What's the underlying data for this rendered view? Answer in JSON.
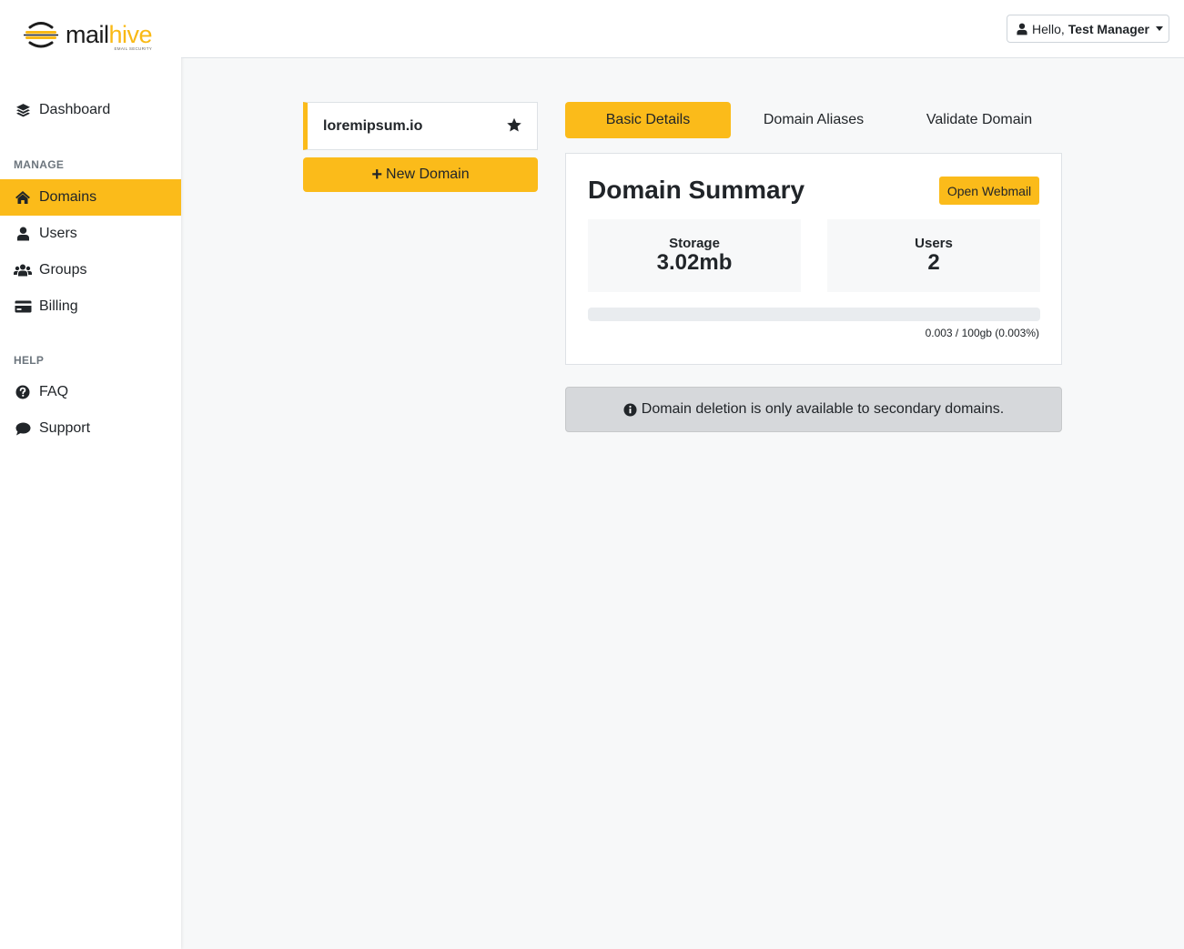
{
  "brand": {
    "word_a": "mail",
    "word_b": "hive",
    "tagline": "EMAIL SECURITY",
    "accent": "#fbbb1a"
  },
  "sidebar": {
    "dashboard": {
      "label": "Dashboard",
      "icon": "layers-icon"
    },
    "sections": [
      {
        "title": "MANAGE",
        "items": [
          {
            "label": "Domains",
            "icon": "home-icon",
            "active": true
          },
          {
            "label": "Users",
            "icon": "user-icon"
          },
          {
            "label": "Groups",
            "icon": "users-icon"
          },
          {
            "label": "Billing",
            "icon": "credit-card-icon"
          }
        ]
      },
      {
        "title": "HELP",
        "items": [
          {
            "label": "FAQ",
            "icon": "question-circle-icon"
          },
          {
            "label": "Support",
            "icon": "comment-icon"
          }
        ]
      }
    ]
  },
  "topbar": {
    "greeting": "Hello,",
    "user_name": "Test Manager"
  },
  "domains": {
    "items": [
      {
        "name": "loremipsum.io",
        "starred": true
      }
    ],
    "new_button": "New Domain"
  },
  "tabs": [
    {
      "label": "Basic Details",
      "active": true
    },
    {
      "label": "Domain Aliases"
    },
    {
      "label": "Validate Domain"
    }
  ],
  "summary": {
    "title": "Domain Summary",
    "webmail_button": "Open Webmail",
    "storage": {
      "label": "Storage",
      "value": "3.02mb"
    },
    "users": {
      "label": "Users",
      "value": "2"
    },
    "usage_text": "0.003 / 100gb (0.003%)",
    "usage_percent": 0.003
  },
  "alert": {
    "text": "Domain deletion is only available to secondary domains."
  }
}
